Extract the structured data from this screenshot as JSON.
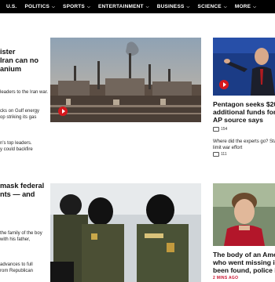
{
  "nav": {
    "items": [
      {
        "label": "U.S.",
        "chev": false
      },
      {
        "label": "POLITICS",
        "chev": true
      },
      {
        "label": "SPORTS",
        "chev": true
      },
      {
        "label": "ENTERTAINMENT",
        "chev": true
      },
      {
        "label": "BUSINESS",
        "chev": true
      },
      {
        "label": "SCIENCE",
        "chev": true
      },
      {
        "label": "MORE",
        "chev": true
      }
    ]
  },
  "left": {
    "headline1": "ister\nIran can no\nanium",
    "b1": "leaders to the Iran war.",
    "b2a": "cks on Gulf energy",
    "b2b": "op striking its gas",
    "b3a": "n's top leaders.",
    "b3b": "y could backfire",
    "headline2": "mask federal\nnts — and",
    "b4a": "the family of the boy",
    "b4b": "with his father,",
    "b5a": "advances to full",
    "b5b": "rom Republican"
  },
  "right": {
    "story1_title_1": "Pentagon seeks $200",
    "story1_title_2": "additional funds for",
    "story1_title_3": "AP source says",
    "story1_comments": "154",
    "story2_title_1": "Where did the experts go? Sta",
    "story2_title_2": "limit war effort",
    "story2_comments": "111",
    "story3_title_1": "The body of an Amer",
    "story3_title_2": "who went missing in",
    "story3_title_3": "been found, police in",
    "story3_time": "2 MINS AGO"
  }
}
